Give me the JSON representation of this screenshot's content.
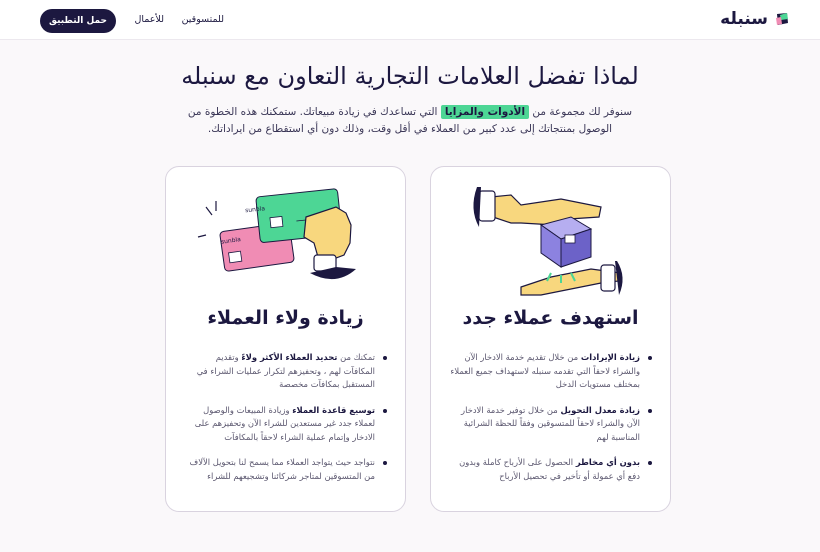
{
  "nav": {
    "brand": "سنبله",
    "link_devs": "للمتسوقين",
    "link_biz": "للأعمال",
    "cta": "حمل التطبيق"
  },
  "hero": {
    "title": "لماذا تفضل العلامات التجارية التعاون مع سنبله",
    "subtitle_pre": "سنوفر لك مجموعة من",
    "subtitle_highlight": "الأدوات والمزايا",
    "subtitle_post": "التي تساعدك في زيادة مبيعاتك. ستمكنك هذه الخطوة من الوصول بمنتجاتك إلى عدد كبير من العملاء في أقل وقت، وذلك دون أي استقطاع من ايراداتك."
  },
  "cards": [
    {
      "title": "استهدف عملاء جدد",
      "illustration_icon": "hands-holding-box-icon",
      "bullets": [
        {
          "bold": "زيادة الإيرادات",
          "text": "من خلال تقديم خدمة الادخار الآن والشراء لاحقاً التي تقدمه سنبله لاستهداف جميع العملاء بمختلف مستويات الدخل"
        },
        {
          "bold": "زيادة معدل التحويل",
          "text": "من خلال توفير خدمة الادخار الآن والشراء لاحقاً للمتسوقين وفقاً للحظة الشرائية المناسبة لهم"
        },
        {
          "bold": "بدون أي مخاطر",
          "text": "الحصول على الأرباح كاملة وبدون دفع أي عمولة أو تأخير في تحصيل الأرباح"
        }
      ]
    },
    {
      "title": "زيادة ولاء العملاء",
      "illustration_icon": "hand-holding-cards-icon",
      "card_labels": [
        "sunbla",
        "sunbla"
      ],
      "bullets": [
        {
          "pre": "تمكنك من",
          "bold": "تحديد العملاء الأكثر ولاءً",
          "text": "وتقديم المكافآت لهم ، وتحفيزهم لتكرار عمليات الشراء في المستقبل بمكافآت مخصصة"
        },
        {
          "bold": "توسيع قاعدة العملاء",
          "text": "وزيادة المبيعات والوصول لعملاء جدد غير مستعدين للشراء الآن وتحفيزهم على الادخار وإتمام عملية الشراء لاحقاً بالمكافآت"
        },
        {
          "bold": "",
          "text": "نتواجد حيث يتواجد العملاء مما يسمح لنا بتحويل الآلاف من المتسوقين لمتاجر شركائنا وتشجيعهم للشراء"
        }
      ]
    }
  ],
  "colors": {
    "navy": "#1c1840",
    "green": "#4dd695",
    "purple": "#8c82e0",
    "pink": "#f08cb4",
    "skin": "#f8d77e"
  }
}
